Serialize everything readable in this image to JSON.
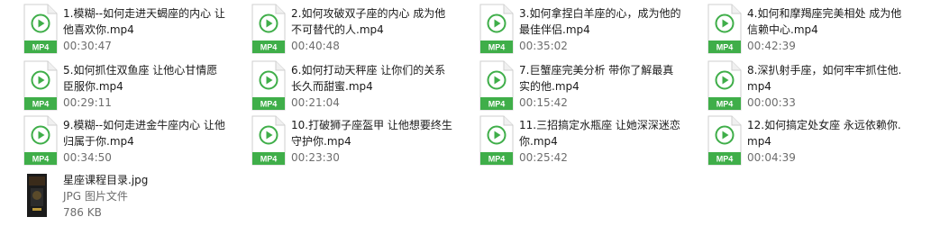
{
  "files": [
    {
      "name": "1.模糊--如何走进天蝎座的内心 让他喜欢你.mp4",
      "duration": "00:30:47",
      "badge": "MP4"
    },
    {
      "name": "2.如何攻破双子座的内心 成为他不可替代的人.mp4",
      "duration": "00:40:48",
      "badge": "MP4"
    },
    {
      "name": "3.如何拿捏白羊座的心，成为他的最佳伴侣.mp4",
      "duration": "00:35:02",
      "badge": "MP4"
    },
    {
      "name": "4.如何和摩羯座完美相处 成为他信赖中心.mp4",
      "duration": "00:42:39",
      "badge": "MP4"
    },
    {
      "name": "5.如何抓住双鱼座 让他心甘情愿臣服你.mp4",
      "duration": "00:29:11",
      "badge": "MP4"
    },
    {
      "name": "6.如何打动天秤座 让你们的关系长久而甜蜜.mp4",
      "duration": "00:21:04",
      "badge": "MP4"
    },
    {
      "name": "7.巨蟹座完美分析 带你了解最真实的他.mp4",
      "duration": "00:15:42",
      "badge": "MP4"
    },
    {
      "name": "8.深扒射手座，如何牢牢抓住他.mp4",
      "duration": "00:00:33",
      "badge": "MP4"
    },
    {
      "name": "9.模糊--如何走进金牛座内心 让他归属于你.mp4",
      "duration": "00:34:50",
      "badge": "MP4"
    },
    {
      "name": "10.打破狮子座盔甲 让他想要终生守护你.mp4",
      "duration": "00:23:30",
      "badge": "MP4"
    },
    {
      "name": "11.三招搞定水瓶座 让她深深迷恋你.mp4",
      "duration": "00:25:42",
      "badge": "MP4"
    },
    {
      "name": "12.如何搞定处女座 永远依赖你.mp4",
      "duration": "00:04:39",
      "badge": "MP4"
    }
  ],
  "image_file": {
    "name": "星座课程目录.jpg",
    "type": "JPG 图片文件",
    "size": "786 KB",
    "thumb_text": "TIEBA"
  },
  "colors": {
    "accent": "#3fae49",
    "icon_bg": "#ffffff",
    "text_primary": "#1a1a1a",
    "text_secondary": "#6d6d6d"
  }
}
